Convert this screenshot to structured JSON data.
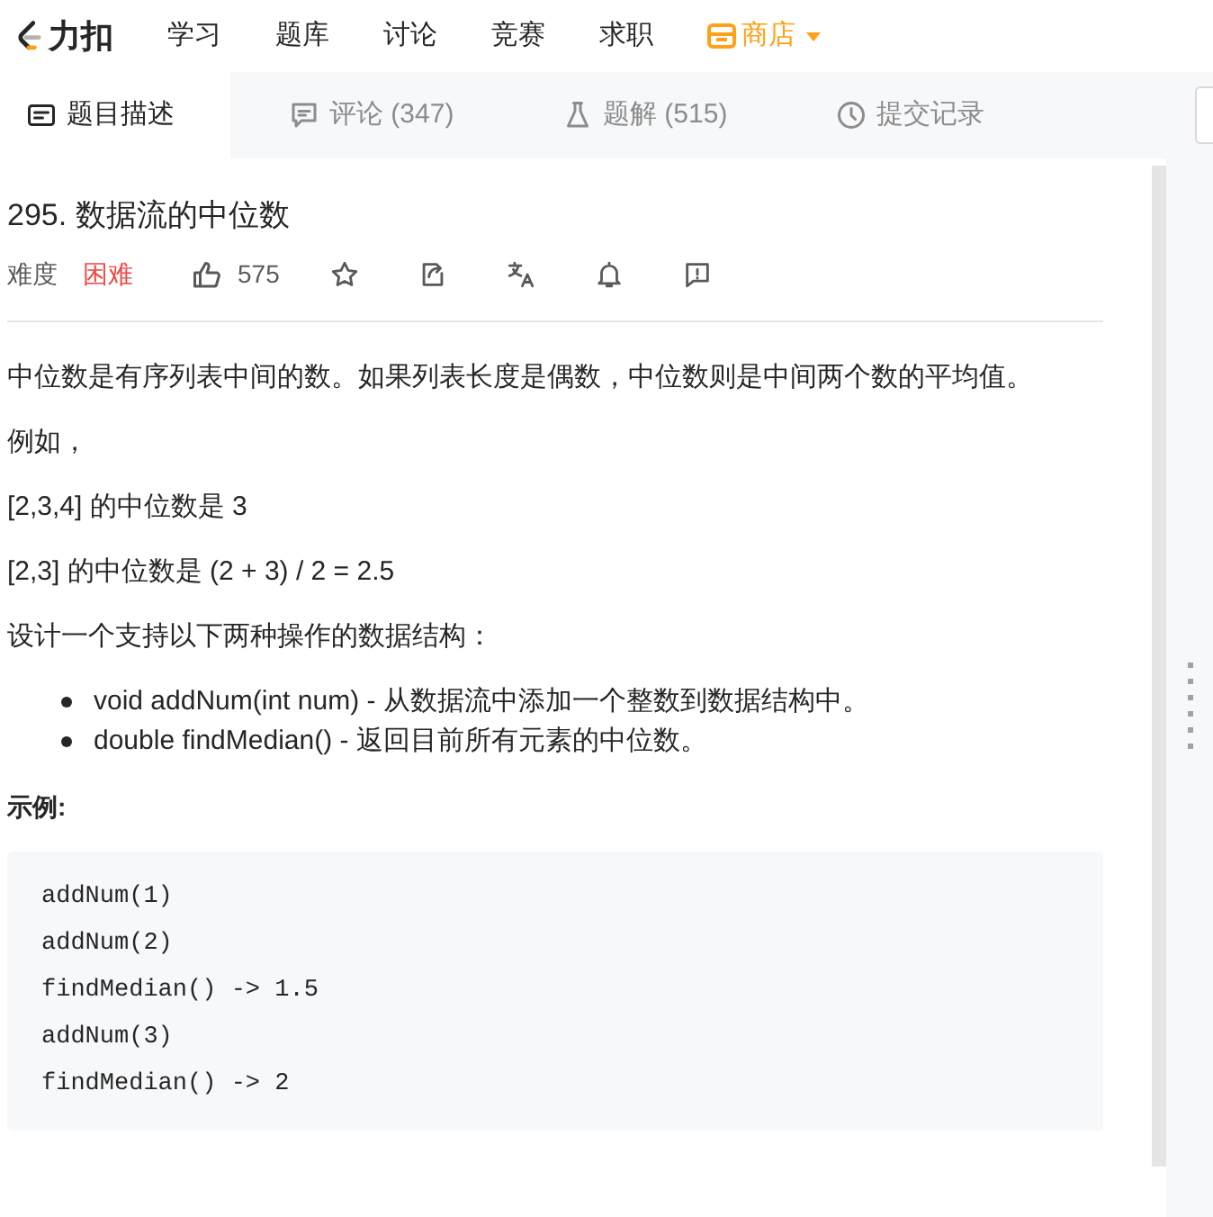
{
  "nav": {
    "logo": "力扣",
    "items": [
      {
        "label": "学习",
        "kind": "link"
      },
      {
        "label": "题库",
        "kind": "link"
      },
      {
        "label": "讨论",
        "kind": "link"
      },
      {
        "label": "竞赛",
        "kind": "link"
      },
      {
        "label": "求职",
        "kind": "link"
      },
      {
        "label": "商店",
        "kind": "store"
      }
    ]
  },
  "tabs": [
    {
      "label": "题目描述",
      "selected": true
    },
    {
      "label": "评论 (347)",
      "selected": false
    },
    {
      "label": "题解 (515)",
      "selected": false
    },
    {
      "label": "提交记录",
      "selected": false
    }
  ],
  "problem": {
    "title": "295. 数据流的中位数",
    "difficulty_label": "难度",
    "difficulty": "困难",
    "likes": "575"
  },
  "content": [
    {
      "kind": "p",
      "text": "中位数是有序列表中间的数。如果列表长度是偶数，中位数则是中间两个数的平均值。"
    },
    {
      "kind": "p",
      "text": "例如，"
    },
    {
      "kind": "p",
      "text": "[2,3,4] 的中位数是 3"
    },
    {
      "kind": "p",
      "text": "[2,3] 的中位数是 (2 + 3) / 2 = 2.5"
    },
    {
      "kind": "p",
      "text": "设计一个支持以下两种操作的数据结构："
    },
    {
      "kind": "list",
      "items": [
        "void addNum(int num) - 从数据流中添加一个整数到数据结构中。",
        "double findMedian() - 返回目前所有元素的中位数。"
      ]
    },
    {
      "kind": "heading",
      "text": "示例:"
    },
    {
      "kind": "code",
      "lines": [
        "addNum(1)",
        "addNum(2)",
        "findMedian() -> 1.5",
        "addNum(3)",
        "findMedian() -> 2"
      ]
    }
  ]
}
